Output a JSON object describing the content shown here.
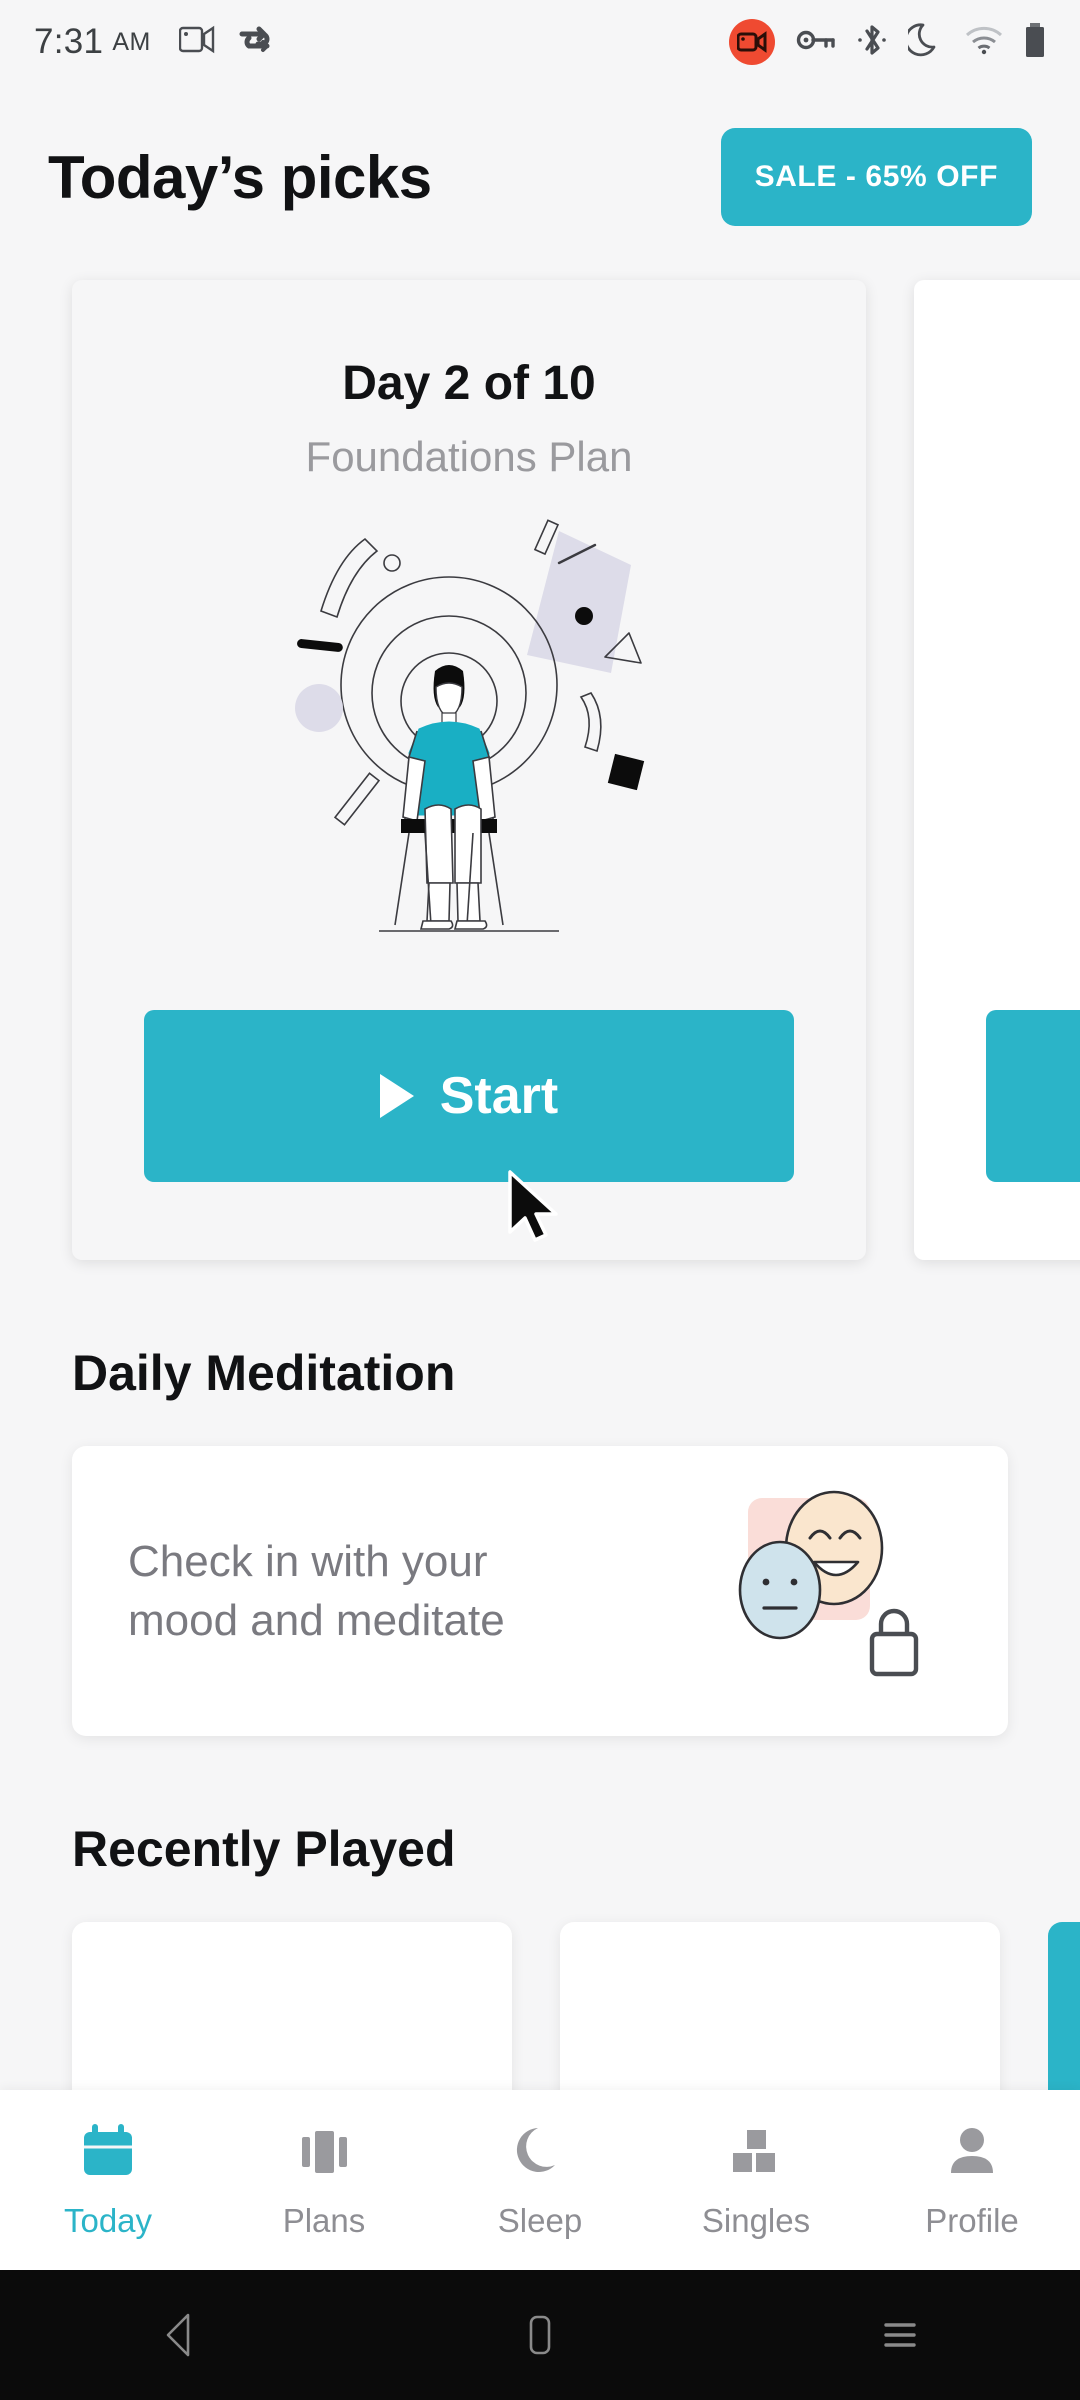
{
  "status_bar": {
    "time": "7:31",
    "ampm": "AM",
    "left_icons": [
      "screen-cast-icon",
      "vpn-sync-icon"
    ],
    "right_icons": [
      "screen-record-icon",
      "vpn-key-icon",
      "bluetooth-icon",
      "do-not-disturb-moon-icon",
      "wifi-icon",
      "battery-icon"
    ],
    "record_badge_color": "#EF4A31"
  },
  "header": {
    "title": "Today’s picks",
    "sale_button": "SALE - 65% OFF"
  },
  "theme": {
    "accent": "#2BB4C8",
    "page_bg": "#F6F6F7",
    "card_bg": "#FFFFFF",
    "muted_text": "#9A9A9E",
    "lavender": "#DDDCE9",
    "mood_pink": "#FADDD8",
    "mood_face_blue": "#CFE3EC",
    "mood_face_cream": "#FAE6CE"
  },
  "carousel": {
    "cards": [
      {
        "title": "Day 2 of 10",
        "subtitle": "Foundations Plan",
        "button_label": "Start",
        "illustration": "seated-person-meditating-illustration"
      },
      {
        "title": "",
        "subtitle": "",
        "button_label": "",
        "illustration": "partial-next-card"
      }
    ]
  },
  "sections": [
    {
      "heading": "Daily Meditation"
    },
    {
      "heading": "Recently Played"
    }
  ],
  "mood_card": {
    "line1": "Check in with your",
    "line2": "mood and meditate",
    "lock_icon": "lock-icon"
  },
  "bottom_nav": {
    "items": [
      {
        "label": "Today",
        "icon": "calendar-icon",
        "active": true
      },
      {
        "label": "Plans",
        "icon": "cards-carousel-icon",
        "active": false
      },
      {
        "label": "Sleep",
        "icon": "moon-icon",
        "active": false
      },
      {
        "label": "Singles",
        "icon": "blocks-icon",
        "active": false
      },
      {
        "label": "Profile",
        "icon": "person-icon",
        "active": false
      }
    ]
  },
  "android_nav": {
    "back": "back-triangle-icon",
    "home": "home-rounded-rect-icon",
    "recents": "recents-hamburger-icon"
  }
}
